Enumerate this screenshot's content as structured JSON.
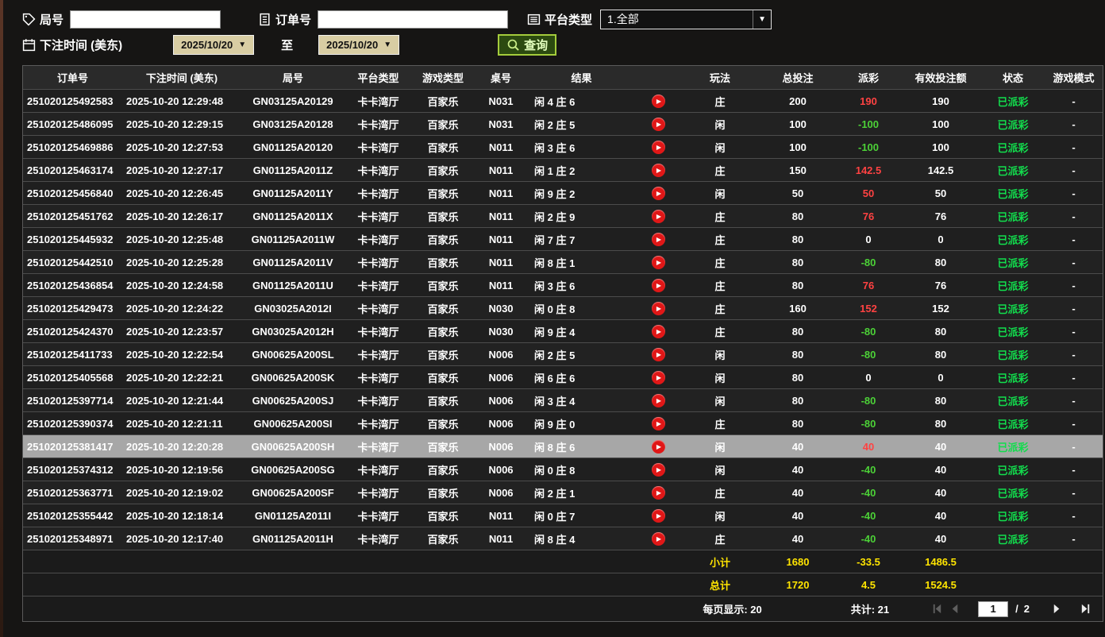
{
  "filters": {
    "round_label": "局号",
    "round_value": "",
    "order_label": "订单号",
    "order_value": "",
    "platform_label": "平台类型",
    "platform_value": "1.全部",
    "time_label": "下注时间 (美东)",
    "date_from": "2025/10/20",
    "to_label": "至",
    "date_to": "2025/10/20",
    "query_label": "查询"
  },
  "table": {
    "headers": [
      {
        "key": "order-id",
        "label": "订单号"
      },
      {
        "key": "bet-time",
        "label": "下注时间 (美东)"
      },
      {
        "key": "round-id",
        "label": "局号"
      },
      {
        "key": "platform",
        "label": "平台类型"
      },
      {
        "key": "game-type",
        "label": "游戏类型"
      },
      {
        "key": "table-no",
        "label": "桌号"
      },
      {
        "key": "result",
        "label": "结果"
      },
      {
        "key": "replay",
        "label": ""
      },
      {
        "key": "play-method",
        "label": "玩法"
      },
      {
        "key": "total-bet",
        "label": "总投注"
      },
      {
        "key": "payout",
        "label": "派彩"
      },
      {
        "key": "valid-bet",
        "label": "有效投注额"
      },
      {
        "key": "status",
        "label": "状态"
      },
      {
        "key": "game-mode",
        "label": "游戏模式"
      }
    ],
    "rows": [
      {
        "order_id": "251020125492583",
        "bet_time": "2025-10-20 12:29:48",
        "round_id": "GN03125A20129",
        "platform": "卡卡湾厅",
        "game_type": "百家乐",
        "table_no": "N031",
        "result": "闲 4 庄 6",
        "play_method": "庄",
        "total_bet": "200",
        "payout": "190",
        "payout_type": "win",
        "valid_bet": "190",
        "status": "已派彩",
        "game_mode": "-",
        "selected": false
      },
      {
        "order_id": "251020125486095",
        "bet_time": "2025-10-20 12:29:15",
        "round_id": "GN03125A20128",
        "platform": "卡卡湾厅",
        "game_type": "百家乐",
        "table_no": "N031",
        "result": "闲 2 庄 5",
        "play_method": "闲",
        "total_bet": "100",
        "payout": "-100",
        "payout_type": "loss",
        "valid_bet": "100",
        "status": "已派彩",
        "game_mode": "-",
        "selected": false
      },
      {
        "order_id": "251020125469886",
        "bet_time": "2025-10-20 12:27:53",
        "round_id": "GN01125A20120",
        "platform": "卡卡湾厅",
        "game_type": "百家乐",
        "table_no": "N011",
        "result": "闲 3 庄 6",
        "play_method": "闲",
        "total_bet": "100",
        "payout": "-100",
        "payout_type": "loss",
        "valid_bet": "100",
        "status": "已派彩",
        "game_mode": "-",
        "selected": false
      },
      {
        "order_id": "251020125463174",
        "bet_time": "2025-10-20 12:27:17",
        "round_id": "GN01125A2011Z",
        "platform": "卡卡湾厅",
        "game_type": "百家乐",
        "table_no": "N011",
        "result": "闲 1 庄 2",
        "play_method": "庄",
        "total_bet": "150",
        "payout": "142.5",
        "payout_type": "win",
        "valid_bet": "142.5",
        "status": "已派彩",
        "game_mode": "-",
        "selected": false
      },
      {
        "order_id": "251020125456840",
        "bet_time": "2025-10-20 12:26:45",
        "round_id": "GN01125A2011Y",
        "platform": "卡卡湾厅",
        "game_type": "百家乐",
        "table_no": "N011",
        "result": "闲 9 庄 2",
        "play_method": "闲",
        "total_bet": "50",
        "payout": "50",
        "payout_type": "win",
        "valid_bet": "50",
        "status": "已派彩",
        "game_mode": "-",
        "selected": false
      },
      {
        "order_id": "251020125451762",
        "bet_time": "2025-10-20 12:26:17",
        "round_id": "GN01125A2011X",
        "platform": "卡卡湾厅",
        "game_type": "百家乐",
        "table_no": "N011",
        "result": "闲 2 庄 9",
        "play_method": "庄",
        "total_bet": "80",
        "payout": "76",
        "payout_type": "win",
        "valid_bet": "76",
        "status": "已派彩",
        "game_mode": "-",
        "selected": false
      },
      {
        "order_id": "251020125445932",
        "bet_time": "2025-10-20 12:25:48",
        "round_id": "GN01125A2011W",
        "platform": "卡卡湾厅",
        "game_type": "百家乐",
        "table_no": "N011",
        "result": "闲 7 庄 7",
        "play_method": "庄",
        "total_bet": "80",
        "payout": "0",
        "payout_type": "zero",
        "valid_bet": "0",
        "status": "已派彩",
        "game_mode": "-",
        "selected": false
      },
      {
        "order_id": "251020125442510",
        "bet_time": "2025-10-20 12:25:28",
        "round_id": "GN01125A2011V",
        "platform": "卡卡湾厅",
        "game_type": "百家乐",
        "table_no": "N011",
        "result": "闲 8 庄 1",
        "play_method": "庄",
        "total_bet": "80",
        "payout": "-80",
        "payout_type": "loss",
        "valid_bet": "80",
        "status": "已派彩",
        "game_mode": "-",
        "selected": false
      },
      {
        "order_id": "251020125436854",
        "bet_time": "2025-10-20 12:24:58",
        "round_id": "GN01125A2011U",
        "platform": "卡卡湾厅",
        "game_type": "百家乐",
        "table_no": "N011",
        "result": "闲 3 庄 6",
        "play_method": "庄",
        "total_bet": "80",
        "payout": "76",
        "payout_type": "win",
        "valid_bet": "76",
        "status": "已派彩",
        "game_mode": "-",
        "selected": false
      },
      {
        "order_id": "251020125429473",
        "bet_time": "2025-10-20 12:24:22",
        "round_id": "GN03025A2012I",
        "platform": "卡卡湾厅",
        "game_type": "百家乐",
        "table_no": "N030",
        "result": "闲 0 庄 8",
        "play_method": "庄",
        "total_bet": "160",
        "payout": "152",
        "payout_type": "win",
        "valid_bet": "152",
        "status": "已派彩",
        "game_mode": "-",
        "selected": false
      },
      {
        "order_id": "251020125424370",
        "bet_time": "2025-10-20 12:23:57",
        "round_id": "GN03025A2012H",
        "platform": "卡卡湾厅",
        "game_type": "百家乐",
        "table_no": "N030",
        "result": "闲 9 庄 4",
        "play_method": "庄",
        "total_bet": "80",
        "payout": "-80",
        "payout_type": "loss",
        "valid_bet": "80",
        "status": "已派彩",
        "game_mode": "-",
        "selected": false
      },
      {
        "order_id": "251020125411733",
        "bet_time": "2025-10-20 12:22:54",
        "round_id": "GN00625A200SL",
        "platform": "卡卡湾厅",
        "game_type": "百家乐",
        "table_no": "N006",
        "result": "闲 2 庄 5",
        "play_method": "闲",
        "total_bet": "80",
        "payout": "-80",
        "payout_type": "loss",
        "valid_bet": "80",
        "status": "已派彩",
        "game_mode": "-",
        "selected": false
      },
      {
        "order_id": "251020125405568",
        "bet_time": "2025-10-20 12:22:21",
        "round_id": "GN00625A200SK",
        "platform": "卡卡湾厅",
        "game_type": "百家乐",
        "table_no": "N006",
        "result": "闲 6 庄 6",
        "play_method": "闲",
        "total_bet": "80",
        "payout": "0",
        "payout_type": "zero",
        "valid_bet": "0",
        "status": "已派彩",
        "game_mode": "-",
        "selected": false
      },
      {
        "order_id": "251020125397714",
        "bet_time": "2025-10-20 12:21:44",
        "round_id": "GN00625A200SJ",
        "platform": "卡卡湾厅",
        "game_type": "百家乐",
        "table_no": "N006",
        "result": "闲 3 庄 4",
        "play_method": "闲",
        "total_bet": "80",
        "payout": "-80",
        "payout_type": "loss",
        "valid_bet": "80",
        "status": "已派彩",
        "game_mode": "-",
        "selected": false
      },
      {
        "order_id": "251020125390374",
        "bet_time": "2025-10-20 12:21:11",
        "round_id": "GN00625A200SI",
        "platform": "卡卡湾厅",
        "game_type": "百家乐",
        "table_no": "N006",
        "result": "闲 9 庄 0",
        "play_method": "庄",
        "total_bet": "80",
        "payout": "-80",
        "payout_type": "loss",
        "valid_bet": "80",
        "status": "已派彩",
        "game_mode": "-",
        "selected": false
      },
      {
        "order_id": "251020125381417",
        "bet_time": "2025-10-20 12:20:28",
        "round_id": "GN00625A200SH",
        "platform": "卡卡湾厅",
        "game_type": "百家乐",
        "table_no": "N006",
        "result": "闲 8 庄 6",
        "play_method": "闲",
        "total_bet": "40",
        "payout": "40",
        "payout_type": "win",
        "valid_bet": "40",
        "status": "已派彩",
        "game_mode": "-",
        "selected": true
      },
      {
        "order_id": "251020125374312",
        "bet_time": "2025-10-20 12:19:56",
        "round_id": "GN00625A200SG",
        "platform": "卡卡湾厅",
        "game_type": "百家乐",
        "table_no": "N006",
        "result": "闲 0 庄 8",
        "play_method": "闲",
        "total_bet": "40",
        "payout": "-40",
        "payout_type": "loss",
        "valid_bet": "40",
        "status": "已派彩",
        "game_mode": "-",
        "selected": false
      },
      {
        "order_id": "251020125363771",
        "bet_time": "2025-10-20 12:19:02",
        "round_id": "GN00625A200SF",
        "platform": "卡卡湾厅",
        "game_type": "百家乐",
        "table_no": "N006",
        "result": "闲 2 庄 1",
        "play_method": "庄",
        "total_bet": "40",
        "payout": "-40",
        "payout_type": "loss",
        "valid_bet": "40",
        "status": "已派彩",
        "game_mode": "-",
        "selected": false
      },
      {
        "order_id": "251020125355442",
        "bet_time": "2025-10-20 12:18:14",
        "round_id": "GN01125A2011I",
        "platform": "卡卡湾厅",
        "game_type": "百家乐",
        "table_no": "N011",
        "result": "闲 0 庄 7",
        "play_method": "闲",
        "total_bet": "40",
        "payout": "-40",
        "payout_type": "loss",
        "valid_bet": "40",
        "status": "已派彩",
        "game_mode": "-",
        "selected": false
      },
      {
        "order_id": "251020125348971",
        "bet_time": "2025-10-20 12:17:40",
        "round_id": "GN01125A2011H",
        "platform": "卡卡湾厅",
        "game_type": "百家乐",
        "table_no": "N011",
        "result": "闲 8 庄 4",
        "play_method": "庄",
        "total_bet": "40",
        "payout": "-40",
        "payout_type": "loss",
        "valid_bet": "40",
        "status": "已派彩",
        "game_mode": "-",
        "selected": false
      }
    ],
    "subtotal": {
      "label": "小计",
      "total_bet": "1680",
      "payout": "-33.5",
      "valid_bet": "1486.5"
    },
    "total": {
      "label": "总计",
      "total_bet": "1720",
      "payout": "4.5",
      "valid_bet": "1524.5"
    }
  },
  "pagination": {
    "per_page_text": "每页显示: 20",
    "total_text": "共计: 21",
    "page": "1",
    "separator": "/",
    "total_pages": "2"
  },
  "colors": {
    "payout_win": "#ff4242",
    "payout_loss": "#4cd137",
    "status_paid": "#12dd4d",
    "summary_value": "#ffe400",
    "query_border": "#a4cc3c",
    "date_button_bg": "#d8cda3",
    "replay_button": "#e01717"
  }
}
